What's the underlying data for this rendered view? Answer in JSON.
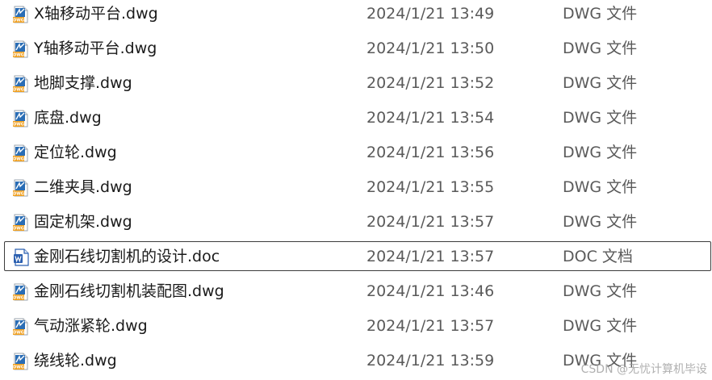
{
  "files": [
    {
      "name": "X轴移动平台.dwg",
      "modified": "2024/1/21 13:49",
      "type": "DWG 文件",
      "icon": "dwg-icon"
    },
    {
      "name": "Y轴移动平台.dwg",
      "modified": "2024/1/21 13:50",
      "type": "DWG 文件",
      "icon": "dwg-icon"
    },
    {
      "name": "地脚支撑.dwg",
      "modified": "2024/1/21 13:52",
      "type": "DWG 文件",
      "icon": "dwg-icon"
    },
    {
      "name": "底盘.dwg",
      "modified": "2024/1/21 13:54",
      "type": "DWG 文件",
      "icon": "dwg-icon"
    },
    {
      "name": "定位轮.dwg",
      "modified": "2024/1/21 13:56",
      "type": "DWG 文件",
      "icon": "dwg-icon"
    },
    {
      "name": "二维夹具.dwg",
      "modified": "2024/1/21 13:55",
      "type": "DWG 文件",
      "icon": "dwg-icon"
    },
    {
      "name": "固定机架.dwg",
      "modified": "2024/1/21 13:57",
      "type": "DWG 文件",
      "icon": "dwg-icon"
    },
    {
      "name": "金刚石线切割机的设计.doc",
      "modified": "2024/1/21 13:57",
      "type": "DOC 文档",
      "icon": "word-doc-icon"
    },
    {
      "name": "金刚石线切割机装配图.dwg",
      "modified": "2024/1/21 13:46",
      "type": "DWG 文件",
      "icon": "dwg-icon"
    },
    {
      "name": "气动涨紧轮.dwg",
      "modified": "2024/1/21 13:57",
      "type": "DWG 文件",
      "icon": "dwg-icon"
    },
    {
      "name": "绕线轮.dwg",
      "modified": "2024/1/21 13:59",
      "type": "DWG 文件",
      "icon": "dwg-icon"
    }
  ],
  "focused_index": 7,
  "watermark": "CSDN @无忧计算机毕设",
  "colors": {
    "dwg_icon_blue": "#2a6db5",
    "dwg_icon_orange": "#f0a020",
    "word_icon_blue": "#2b5fb0",
    "focus_border": "#3c3c3c"
  }
}
